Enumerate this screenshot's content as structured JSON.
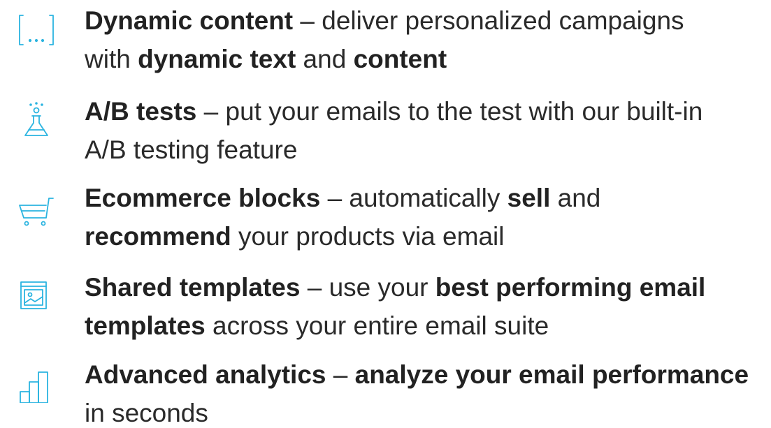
{
  "colors": {
    "accent": "#2bb4e0",
    "text": "#2a2a2a"
  },
  "features": [
    {
      "icon": "dynamic-content-icon",
      "line1": [
        {
          "text": "Dynamic content",
          "bold": true
        },
        {
          "text": " – deliver personalized campaigns",
          "bold": false
        }
      ],
      "line2": [
        {
          "text": "with ",
          "bold": false
        },
        {
          "text": "dynamic text",
          "bold": true
        },
        {
          "text": " and ",
          "bold": false
        },
        {
          "text": "content",
          "bold": true
        }
      ]
    },
    {
      "icon": "flask-icon",
      "line1": [
        {
          "text": "A/B tests",
          "bold": true
        },
        {
          "text": " – put your emails to the test with our built-in",
          "bold": false
        }
      ],
      "line2": [
        {
          "text": "A/B testing feature",
          "bold": false
        }
      ]
    },
    {
      "icon": "shopping-cart-icon",
      "line1": [
        {
          "text": "Ecommerce blocks",
          "bold": true
        },
        {
          "text": " – automatically ",
          "bold": false
        },
        {
          "text": "sell",
          "bold": true
        },
        {
          "text": " and",
          "bold": false
        }
      ],
      "line2": [
        {
          "text": "recommend",
          "bold": true
        },
        {
          "text": " your products via email",
          "bold": false
        }
      ]
    },
    {
      "icon": "template-image-icon",
      "line1": [
        {
          "text": "Shared templates",
          "bold": true
        },
        {
          "text": " – use your ",
          "bold": false
        },
        {
          "text": "best performing email",
          "bold": true
        }
      ],
      "line2": [
        {
          "text": "templates",
          "bold": true
        },
        {
          "text": " across your entire email suite",
          "bold": false
        }
      ]
    },
    {
      "icon": "bar-chart-icon",
      "line1": [
        {
          "text": "Advanced analytics",
          "bold": true
        },
        {
          "text": " – ",
          "bold": false
        },
        {
          "text": "analyze your email performance",
          "bold": true
        }
      ],
      "line2": [
        {
          "text": "in seconds",
          "bold": false
        }
      ]
    }
  ]
}
